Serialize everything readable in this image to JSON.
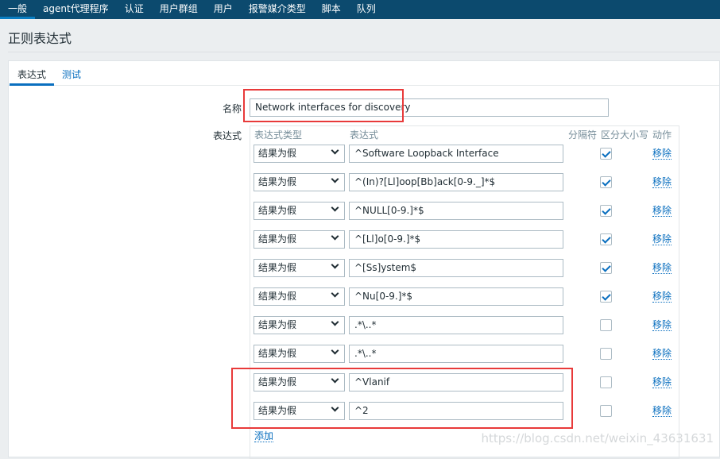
{
  "nav": {
    "items": [
      "一般",
      "agent代理程序",
      "认证",
      "用户群组",
      "用户",
      "报警媒介类型",
      "脚本",
      "队列"
    ],
    "active": 0
  },
  "page_title": "正则表达式",
  "tabs": [
    "表达式",
    "测试"
  ],
  "form": {
    "name_label": "名称",
    "name_value": "Network interfaces for discovery",
    "expr_label": "表达式"
  },
  "table": {
    "headers": [
      "表达式类型",
      "表达式",
      "分隔符",
      "区分大小写",
      "动作"
    ],
    "rows": [
      {
        "type": "结果为假",
        "expr": "^Software Loopback Interface",
        "case": true,
        "action": "移除"
      },
      {
        "type": "结果为假",
        "expr": "^(In)?[Ll]oop[Bb]ack[0-9._]*$",
        "case": true,
        "action": "移除"
      },
      {
        "type": "结果为假",
        "expr": "^NULL[0-9.]*$",
        "case": true,
        "action": "移除"
      },
      {
        "type": "结果为假",
        "expr": "^[Ll]o[0-9.]*$",
        "case": true,
        "action": "移除"
      },
      {
        "type": "结果为假",
        "expr": "^[Ss]ystem$",
        "case": true,
        "action": "移除"
      },
      {
        "type": "结果为假",
        "expr": "^Nu[0-9.]*$",
        "case": true,
        "action": "移除"
      },
      {
        "type": "结果为假",
        "expr": ".*\\..*",
        "case": false,
        "action": "移除"
      },
      {
        "type": "结果为假",
        "expr": ".*\\..*",
        "case": false,
        "action": "移除"
      },
      {
        "type": "结果为假",
        "expr": "^Vlanif",
        "case": false,
        "action": "移除"
      },
      {
        "type": "结果为假",
        "expr": "^2",
        "case": false,
        "action": "移除"
      }
    ],
    "add_label": "添加"
  },
  "watermark": "https://blog.csdn.net/weixin_43631631",
  "colors": {
    "nav_bg": "#0c4a6e",
    "link": "#0a6fbf",
    "highlight": "#e83a3a"
  }
}
